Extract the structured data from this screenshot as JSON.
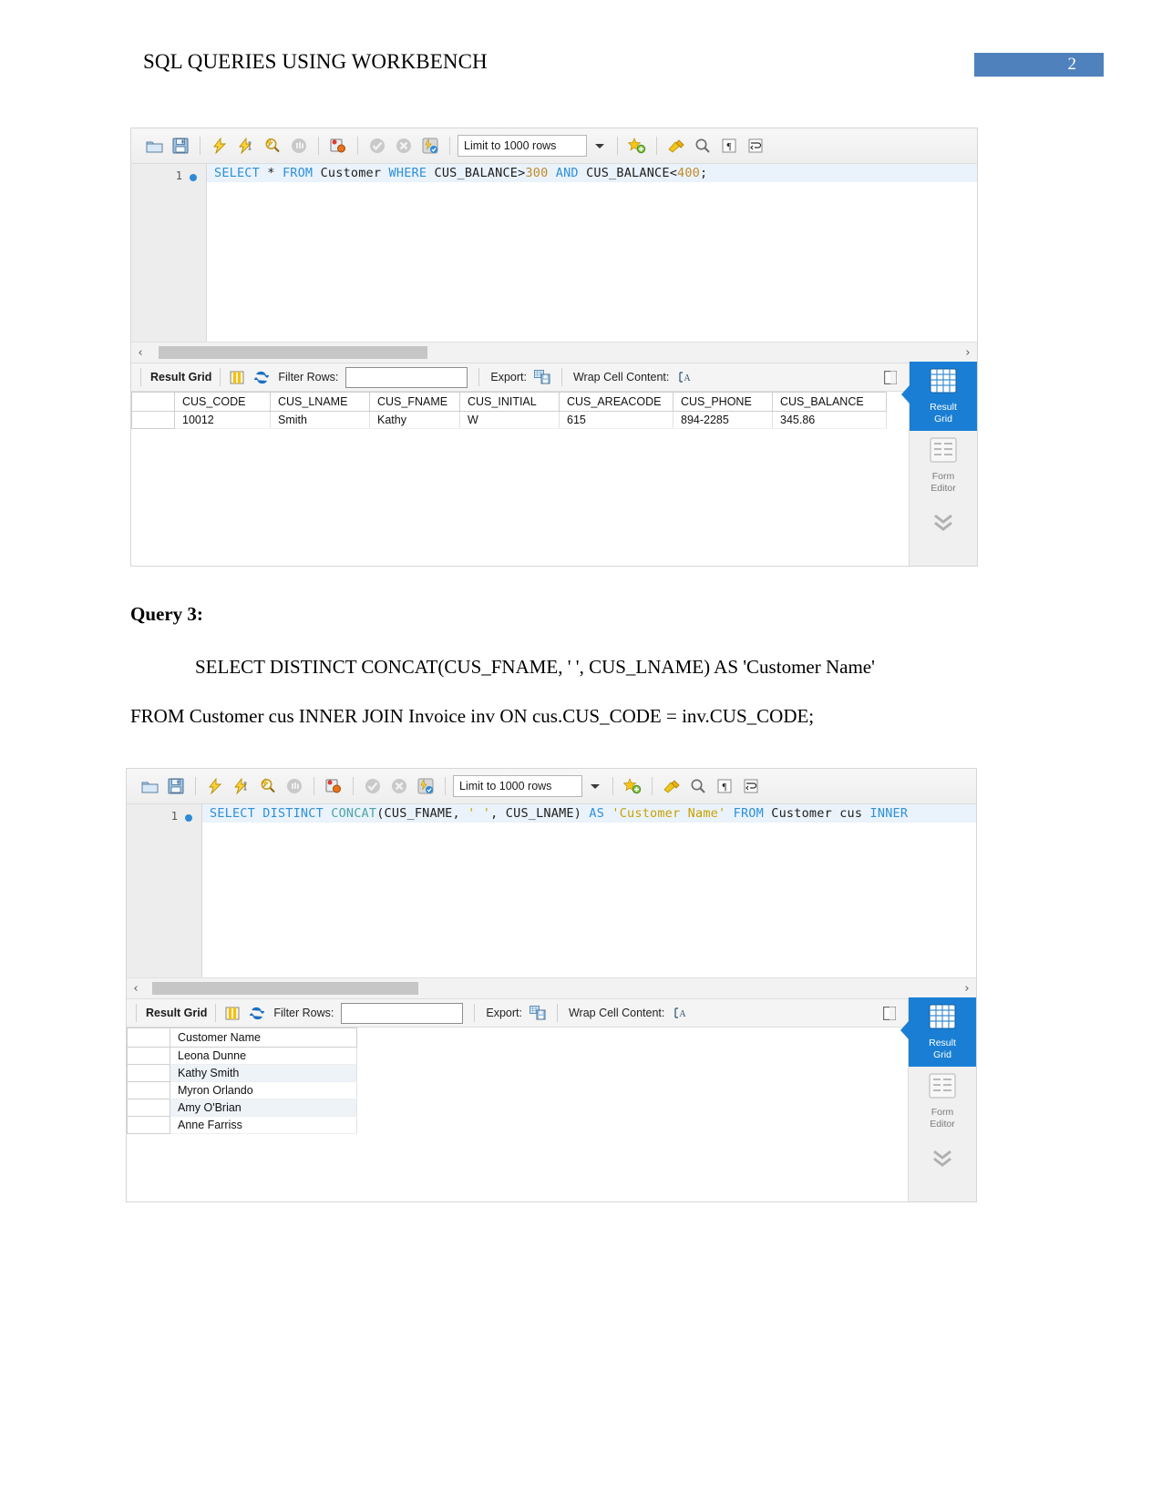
{
  "header": {
    "doc_title": "SQL QUERIES USING WORKBENCH",
    "page_number": "2"
  },
  "toolbar": {
    "icons": [
      "open-folder-icon",
      "save-icon",
      "execute-icon",
      "execute-current-statement-icon",
      "explain-icon",
      "stop-icon",
      "toggle-breakpoint-icon",
      "commit-icon",
      "rollback-icon",
      "autocommit-icon"
    ],
    "limit_label": "Limit to 1000 rows",
    "limit_caret": "chevron-down-icon",
    "right_icons": [
      "new-snippet-icon",
      "beautify-icon",
      "find-icon",
      "invisible-chars-icon",
      "wrap-lines-icon"
    ]
  },
  "result_toolbar": {
    "result_grid_label": "Result Grid",
    "filter_icon": "filter-columns-icon",
    "refresh_icon": "refresh-icon",
    "filter_rows_label": "Filter Rows:",
    "filter_rows_value": "",
    "filter_rows_placeholder": "",
    "export_label": "Export:",
    "export_icon": "export-recordset-icon",
    "wrap_label": "Wrap Cell Content:",
    "wrap_icon": "wrap-cell-icon",
    "fetch_icon": "fetch-rows-icon"
  },
  "sidepanel": {
    "result_grid": {
      "icon": "grid-icon",
      "line1": "Result",
      "line2": "Grid"
    },
    "form_editor": {
      "icon": "form-icon",
      "line1": "Form",
      "line2": "Editor"
    },
    "chevron": "chevron-double-down-icon"
  },
  "workbench_1": {
    "gutter_line_number": "1",
    "sql_tokens": [
      {
        "t": "SELECT",
        "c": "kw"
      },
      {
        "t": " ",
        "c": "plain"
      },
      {
        "t": "*",
        "c": "op"
      },
      {
        "t": " ",
        "c": "plain"
      },
      {
        "t": "FROM",
        "c": "kw"
      },
      {
        "t": " ",
        "c": "plain"
      },
      {
        "t": "Customer",
        "c": "plain"
      },
      {
        "t": " ",
        "c": "plain"
      },
      {
        "t": "WHERE",
        "c": "kw"
      },
      {
        "t": " ",
        "c": "plain"
      },
      {
        "t": "CUS_BALANCE",
        "c": "plain"
      },
      {
        "t": ">",
        "c": "op"
      },
      {
        "t": "300",
        "c": "num"
      },
      {
        "t": " ",
        "c": "plain"
      },
      {
        "t": "AND",
        "c": "kw"
      },
      {
        "t": " ",
        "c": "plain"
      },
      {
        "t": "CUS_BALANCE",
        "c": "plain"
      },
      {
        "t": "<",
        "c": "op"
      },
      {
        "t": "400",
        "c": "num"
      },
      {
        "t": ";",
        "c": "plain"
      }
    ],
    "sql_plain": "SELECT * FROM Customer WHERE CUS_BALANCE>300 AND CUS_BALANCE<400;",
    "grid": {
      "columns": [
        "CUS_CODE",
        "CUS_LNAME",
        "CUS_FNAME",
        "CUS_INITIAL",
        "CUS_AREACODE",
        "CUS_PHONE",
        "CUS_BALANCE"
      ],
      "rows": [
        [
          "10012",
          "Smith",
          "Kathy",
          "W",
          "615",
          "894-2285",
          "345.86"
        ]
      ]
    }
  },
  "query3": {
    "heading": "Query 3:",
    "line1": "SELECT DISTINCT CONCAT(CUS_FNAME, ' ', CUS_LNAME) AS 'Customer Name'",
    "line2": "FROM Customer cus INNER JOIN Invoice inv ON cus.CUS_CODE = inv.CUS_CODE;"
  },
  "workbench_2": {
    "gutter_line_number": "1",
    "sql_tokens": [
      {
        "t": "SELECT",
        "c": "kw"
      },
      {
        "t": " ",
        "c": "plain"
      },
      {
        "t": "DISTINCT",
        "c": "kw"
      },
      {
        "t": " ",
        "c": "plain"
      },
      {
        "t": "CONCAT",
        "c": "fn"
      },
      {
        "t": "(",
        "c": "plain"
      },
      {
        "t": "CUS_FNAME",
        "c": "plain"
      },
      {
        "t": ", ",
        "c": "plain"
      },
      {
        "t": "' '",
        "c": "str"
      },
      {
        "t": ", ",
        "c": "plain"
      },
      {
        "t": "CUS_LNAME",
        "c": "plain"
      },
      {
        "t": ")",
        "c": "plain"
      },
      {
        "t": " ",
        "c": "plain"
      },
      {
        "t": "AS",
        "c": "kw"
      },
      {
        "t": " ",
        "c": "plain"
      },
      {
        "t": "'Customer Name'",
        "c": "str"
      },
      {
        "t": " ",
        "c": "plain"
      },
      {
        "t": "FROM",
        "c": "kw"
      },
      {
        "t": " ",
        "c": "plain"
      },
      {
        "t": "Customer",
        "c": "plain"
      },
      {
        "t": " ",
        "c": "plain"
      },
      {
        "t": "cus",
        "c": "plain"
      },
      {
        "t": " ",
        "c": "plain"
      },
      {
        "t": "INNER",
        "c": "kw"
      }
    ],
    "sql_plain": "SELECT DISTINCT CONCAT(CUS_FNAME, ' ', CUS_LNAME) AS 'Customer Name' FROM Customer cus INNER",
    "grid": {
      "columns": [
        "Customer Name"
      ],
      "rows": [
        [
          "Leona Dunne"
        ],
        [
          "Kathy Smith"
        ],
        [
          "Myron Orlando"
        ],
        [
          "Amy O'Brian"
        ],
        [
          "Anne Farriss"
        ]
      ]
    }
  },
  "colors": {
    "badge": "#4f81bd",
    "panel_active": "#1a7fd4",
    "keyword": "#2f8fd8",
    "string": "#c8a000",
    "number": "#c08a2b",
    "row_alt": "#eef3f8"
  }
}
